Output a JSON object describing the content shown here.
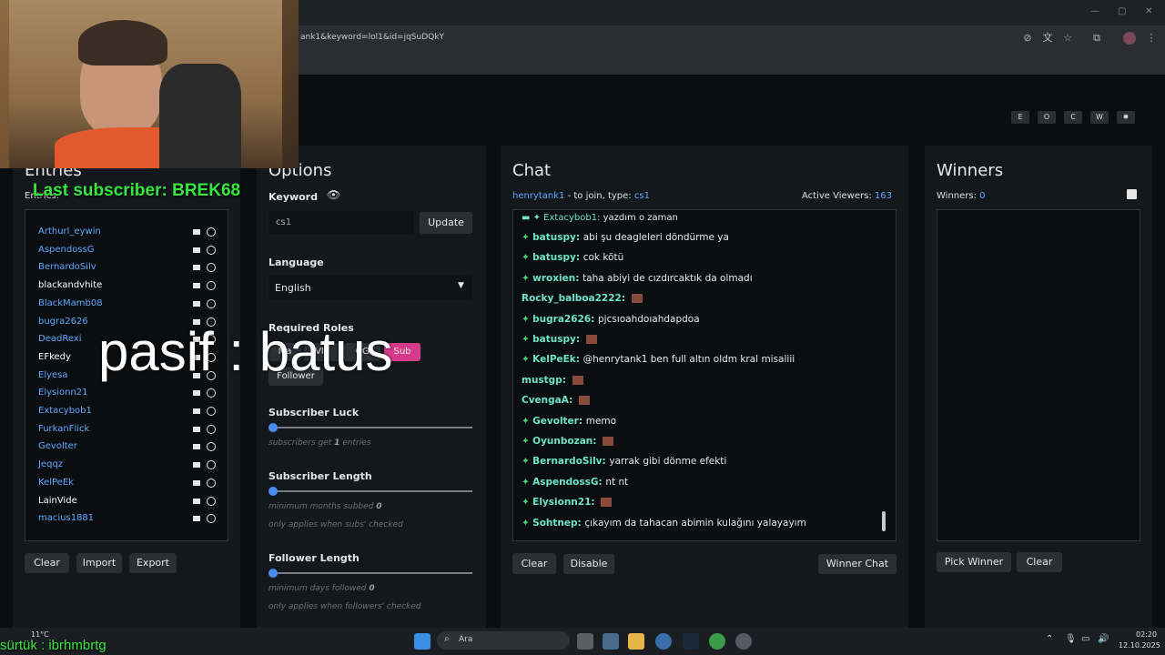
{
  "browser": {
    "url": "ank1&keyword=lol1&id=jqSuDQkY"
  },
  "toggles": [
    "E",
    "O",
    "C",
    "W",
    "✹"
  ],
  "entries": {
    "title": "Entries",
    "count_label": "Entries:",
    "items": [
      {
        "name": "Arthurl_eywin",
        "color": "#5fa8ff"
      },
      {
        "name": "AspendossG",
        "color": "#5fa8ff"
      },
      {
        "name": "BernardoSilv",
        "color": "#5fa8ff"
      },
      {
        "name": "blackandvhite",
        "color": "#ffffff"
      },
      {
        "name": "BlackMamb08",
        "color": "#5fa8ff"
      },
      {
        "name": "bugra2626",
        "color": "#5fa8ff"
      },
      {
        "name": "DeadRexi",
        "color": "#5fa8ff"
      },
      {
        "name": "EFkedy",
        "color": "#ffffff"
      },
      {
        "name": "Elyesa",
        "color": "#5fa8ff"
      },
      {
        "name": "Elysionn21",
        "color": "#5fa8ff"
      },
      {
        "name": "Extacybob1",
        "color": "#5fa8ff"
      },
      {
        "name": "FurkanFlick",
        "color": "#5fa8ff"
      },
      {
        "name": "Gevolter",
        "color": "#5fa8ff"
      },
      {
        "name": "Jeqqz",
        "color": "#5fa8ff"
      },
      {
        "name": "KelPeEk",
        "color": "#5fa8ff"
      },
      {
        "name": "LainVide",
        "color": "#ffffff"
      },
      {
        "name": "macius1881",
        "color": "#5fa8ff"
      }
    ],
    "buttons": {
      "clear": "Clear",
      "import": "Import",
      "export": "Export"
    }
  },
  "options": {
    "title": "Options",
    "keyword_label": "Keyword",
    "keyword_value": "cs1",
    "update_label": "Update",
    "language_label": "Language",
    "language_value": "English",
    "roles_label": "Required Roles",
    "roles": [
      "Ma",
      "VIP",
      "OG",
      "Sub",
      "Follower"
    ],
    "sub_luck_label": "Subscriber Luck",
    "sub_luck_hint_pre": "subscribers get",
    "sub_luck_value": "1",
    "sub_luck_hint_post": "entries",
    "sub_length_label": "Subscriber Length",
    "sub_length_hint_pre": "minimum months subbed",
    "sub_length_value": "0",
    "sub_length_hint2": "only applies when subs' checked",
    "follower_length_label": "Follower Length",
    "follower_length_hint_pre": "minimum days followed",
    "follower_length_value": "0",
    "follower_length_hint2": "only applies when followers' checked"
  },
  "chat": {
    "title": "Chat",
    "channel": "henrytank1",
    "join_text": "- to join, type:",
    "join_keyword": "cs1",
    "viewers_label": "Active Viewers:",
    "viewers_value": "163",
    "messages": [
      {
        "user": "batuspy",
        "text": "abi şu deagleleri döndürme ya",
        "star": true
      },
      {
        "user": "batuspy",
        "text": "cok kötü",
        "star": true
      },
      {
        "user": "wroxien",
        "text": "taha abiyi de cızdırcaktık da olmadı",
        "star": true
      },
      {
        "user": "Rocky_balboa2222",
        "text": "",
        "star": false,
        "emote": true
      },
      {
        "user": "bugra2626",
        "text": "pjcsıoahdoıahdapdoa",
        "star": true
      },
      {
        "user": "batuspy",
        "text": "",
        "star": true,
        "emote": true
      },
      {
        "user": "KelPeEk",
        "text": "@henrytank1 ben full altın oldm kral misaliii",
        "star": true
      },
      {
        "user": "mustgp",
        "text": "",
        "star": false,
        "emote": true
      },
      {
        "user": "CvengaA",
        "text": "",
        "star": false,
        "emote": true
      },
      {
        "user": "Gevolter",
        "text": "memo",
        "star": true
      },
      {
        "user": "Oyunbozan",
        "text": "",
        "star": true,
        "emote": true
      },
      {
        "user": "BernardoSilv",
        "text": "yarrak gibi dönme efekti",
        "star": true
      },
      {
        "user": "AspendossG",
        "text": "nt nt",
        "star": true
      },
      {
        "user": "Elysionn21",
        "text": "",
        "star": true,
        "emote": true
      },
      {
        "user": "Sohtnep",
        "text": "çıkayım da tahacan abimin kulağını yalayayım",
        "star": true
      }
    ],
    "buttons": {
      "clear": "Clear",
      "disable": "Disable",
      "winner_chat": "Winner Chat"
    }
  },
  "winners": {
    "title": "Winners",
    "count_label": "Winners:",
    "count_value": "0",
    "buttons": {
      "pick": "Pick Winner",
      "clear": "Clear"
    }
  },
  "overlays": {
    "big_text": "pasif : batus",
    "last_sub": "Last subscriber: BREK68",
    "bottom_text": "sürtük : ibrhmbrtg"
  },
  "taskbar": {
    "weather_temp": "11°C",
    "search_label": "Ara",
    "time": "02:20",
    "date": "12.10.2025"
  }
}
